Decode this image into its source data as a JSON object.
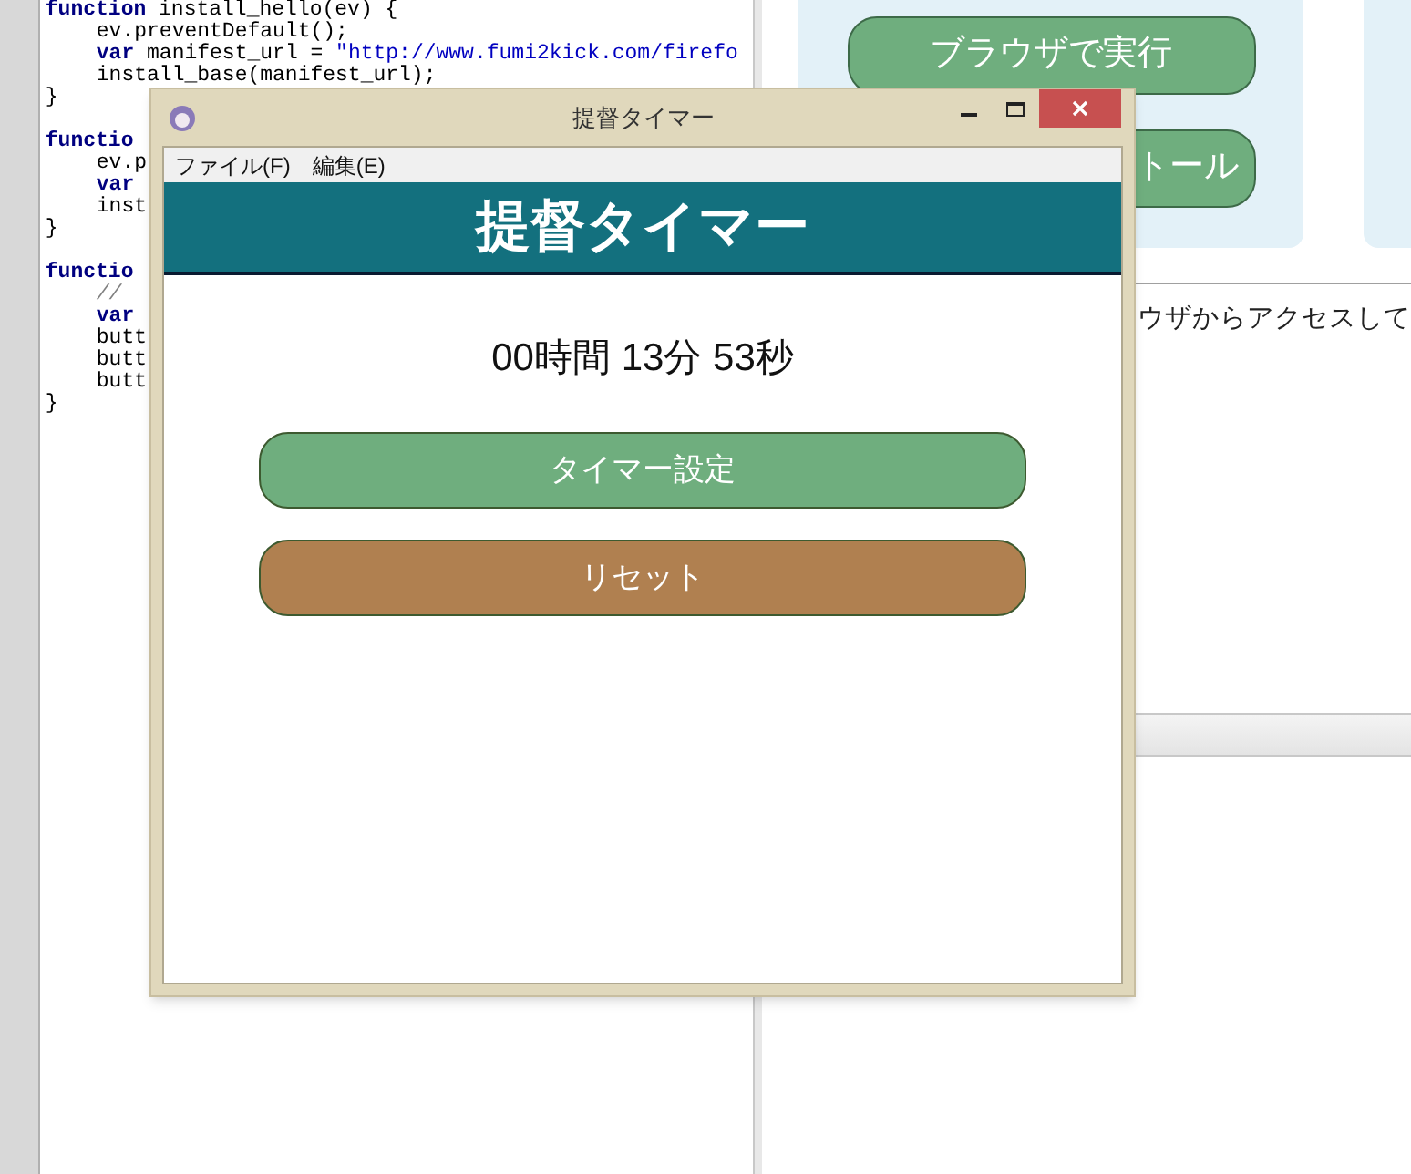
{
  "editor": {
    "lines": [
      {
        "kind": "code",
        "indent": false,
        "segments": [
          {
            "text": "function",
            "kind": "keyword"
          },
          {
            "text": " install_hello(ev) {",
            "kind": "plain"
          }
        ]
      },
      {
        "kind": "code",
        "indent": true,
        "segments": [
          {
            "text": "ev.preventDefault();",
            "kind": "plain"
          }
        ]
      },
      {
        "kind": "code",
        "indent": true,
        "segments": [
          {
            "text": "var",
            "kind": "keyword"
          },
          {
            "text": " manifest_url = ",
            "kind": "plain"
          },
          {
            "text": "\"http://www.fumi2kick.com/firefo",
            "kind": "string"
          }
        ]
      },
      {
        "kind": "code",
        "indent": true,
        "segments": [
          {
            "text": "install_base(manifest_url);",
            "kind": "plain"
          }
        ]
      },
      {
        "kind": "code",
        "indent": false,
        "segments": [
          {
            "text": "}",
            "kind": "plain"
          }
        ]
      },
      {
        "kind": "blank"
      },
      {
        "kind": "code",
        "indent": false,
        "segments": [
          {
            "text": "functio",
            "kind": "keyword"
          }
        ]
      },
      {
        "kind": "code",
        "indent": true,
        "segments": [
          {
            "text": "ev.p",
            "kind": "plain"
          }
        ]
      },
      {
        "kind": "code",
        "indent": true,
        "segments": [
          {
            "text": "var",
            "kind": "keyword"
          }
        ]
      },
      {
        "kind": "code",
        "indent": true,
        "segments": [
          {
            "text": "inst",
            "kind": "plain"
          }
        ]
      },
      {
        "kind": "code",
        "indent": false,
        "segments": [
          {
            "text": "}",
            "kind": "plain"
          }
        ]
      },
      {
        "kind": "blank"
      },
      {
        "kind": "code",
        "indent": false,
        "segments": [
          {
            "text": "functio",
            "kind": "keyword"
          }
        ]
      },
      {
        "kind": "code",
        "indent": true,
        "segments": [
          {
            "text": "//",
            "kind": "comment"
          }
        ]
      },
      {
        "kind": "code",
        "indent": true,
        "segments": [
          {
            "text": "var",
            "kind": "keyword"
          }
        ]
      },
      {
        "kind": "code",
        "indent": true,
        "segments": [
          {
            "text": "butt",
            "kind": "plain"
          }
        ]
      },
      {
        "kind": "code",
        "indent": true,
        "segments": [
          {
            "text": "butt",
            "kind": "plain"
          }
        ]
      },
      {
        "kind": "code",
        "indent": true,
        "segments": [
          {
            "text": "butt",
            "kind": "plain"
          }
        ]
      },
      {
        "kind": "code",
        "indent": false,
        "segments": [
          {
            "text": "}",
            "kind": "plain"
          }
        ]
      }
    ]
  },
  "browser": {
    "buttons": [
      "ブラウザで実行",
      "トール"
    ],
    "text": "ウザからアクセスして"
  },
  "dialog": {
    "title": "提督タイマー",
    "menu": [
      "ファイル(F)",
      "編集(E)"
    ],
    "heading": "提督タイマー",
    "timer": "00時間 13分 53秒",
    "buttons": [
      {
        "label": "タイマー設定",
        "kind": "primary"
      },
      {
        "label": "リセット",
        "kind": "reset"
      }
    ]
  }
}
